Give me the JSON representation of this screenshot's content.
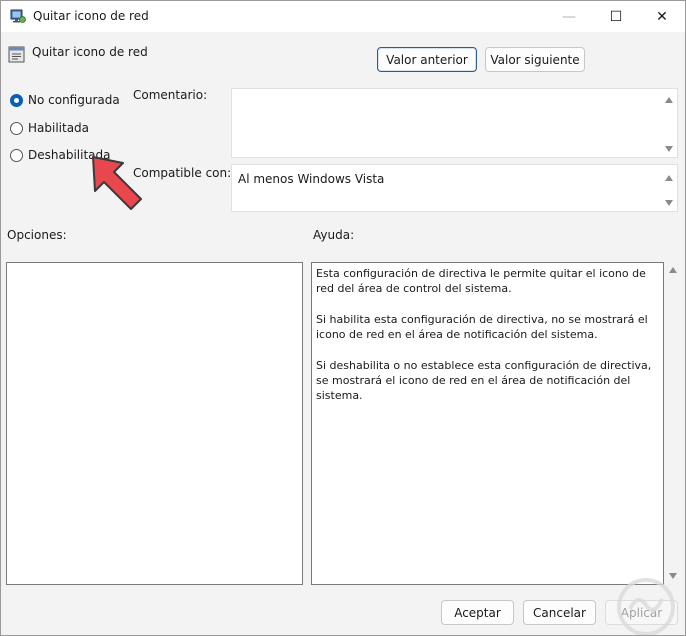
{
  "window": {
    "title": "Quitar icono de red",
    "controls": {
      "minimize": "—",
      "maximize": "☐",
      "close": "✕"
    }
  },
  "header": {
    "policy_name": "Quitar icono de red"
  },
  "nav": {
    "previous_label": "Valor anterior",
    "next_label": "Valor siguiente"
  },
  "state": {
    "options": [
      {
        "label": "No configurada",
        "selected": true
      },
      {
        "label": "Habilitada",
        "selected": false
      },
      {
        "label": "Deshabilitada",
        "selected": false
      }
    ]
  },
  "comment": {
    "label": "Comentario:",
    "value": ""
  },
  "compatible": {
    "label": "Compatible con:",
    "value": "Al menos Windows Vista"
  },
  "options_panel": {
    "label": "Opciones:"
  },
  "help_panel": {
    "label": "Ayuda:",
    "paragraphs": [
      "Esta configuración de directiva le permite quitar el icono de red del área de control del sistema.",
      "Si habilita esta configuración de directiva, no se mostrará el icono de red en el área de notificación del sistema.",
      "Si deshabilita o no establece esta configuración de directiva, se mostrará el icono de red en el área de notificación del sistema."
    ]
  },
  "footer": {
    "accept_label": "Aceptar",
    "cancel_label": "Cancelar",
    "apply_label": "Aplicar"
  },
  "colors": {
    "accent": "#0a5fb5",
    "annotation_arrow": "#e8474d"
  },
  "icons": {
    "title": "policy-icon",
    "header": "policy-setting-icon",
    "annotation": "red-arrow-icon"
  }
}
